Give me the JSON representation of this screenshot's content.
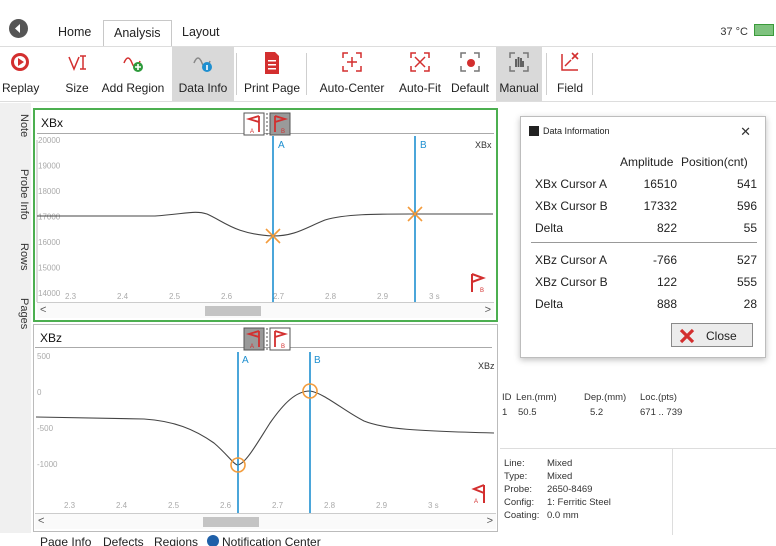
{
  "tabs": {
    "home": "Home",
    "analysis": "Analysis",
    "layout": "Layout"
  },
  "status": {
    "temperature": "37 °C"
  },
  "toolbar": {
    "replay": "Replay",
    "size": "Size",
    "add_region": "Add Region",
    "data_info": "Data Info",
    "print_page": "Print Page",
    "auto_center": "Auto-Center",
    "auto_fit": "Auto-Fit",
    "default": "Default",
    "manual": "Manual",
    "field": "Field"
  },
  "side_tabs": {
    "note": "Note",
    "probe_info": "Probe Info",
    "rows": "Rows",
    "pages": "Pages"
  },
  "panel_xbx": {
    "title": "XBx",
    "channel_label": "XBx",
    "cursor_a": "A",
    "cursor_b": "B",
    "y_ticks": [
      "20000",
      "19000",
      "18000",
      "17000",
      "16000",
      "15000",
      "14000"
    ],
    "x_ticks": [
      "2.3",
      "2.4",
      "2.5",
      "2.6",
      "2.7",
      "2.8",
      "2.9",
      "3 s"
    ]
  },
  "panel_xbz": {
    "title": "XBz",
    "channel_label": "XBz",
    "cursor_a": "A",
    "cursor_b": "B",
    "y_ticks": [
      "500",
      "0",
      "-500",
      "-1000"
    ],
    "x_ticks": [
      "2.3",
      "2.4",
      "2.5",
      "2.6",
      "2.7",
      "2.8",
      "2.9",
      "3 s"
    ]
  },
  "dialog": {
    "title": "Data Information",
    "col_amplitude": "Amplitude",
    "col_position": "Position(cnt)",
    "rows": [
      {
        "label": "XBx Cursor A",
        "amplitude": "16510",
        "position": "541"
      },
      {
        "label": "XBx Cursor B",
        "amplitude": "17332",
        "position": "596"
      },
      {
        "label": "Delta",
        "amplitude": "822",
        "position": "55"
      },
      {
        "label": "XBz Cursor A",
        "amplitude": "-766",
        "position": "527"
      },
      {
        "label": "XBz Cursor B",
        "amplitude": "122",
        "position": "555"
      },
      {
        "label": "Delta",
        "amplitude": "888",
        "position": "28"
      }
    ],
    "close_label": "Close"
  },
  "indication": {
    "hdr_id": "ID",
    "hdr_len": "Len.(mm)",
    "hdr_dep": "Dep.(mm)",
    "hdr_loc": "Loc.(pts)",
    "id": "1",
    "len": "50.5",
    "dep": "5.2",
    "loc": "671 .. 739"
  },
  "probe_info": {
    "line_label": "Line:",
    "line_value": "Mixed",
    "type_label": "Type:",
    "type_value": "Mixed",
    "probe_label": "Probe:",
    "probe_value": "2650-8469",
    "config_label": "Config:",
    "config_value": "1: Ferritic Steel",
    "coating_label": "Coating:",
    "coating_value": "0.0 mm"
  },
  "bottom_tabs": {
    "page_info": "Page Info",
    "defects": "Defects",
    "regions": "Regions",
    "notification": "Notification Center"
  },
  "colors": {
    "accent_green": "#4caf50",
    "cursor_blue": "#1e8fd0",
    "marker_orange": "#f39c3c",
    "brand_red": "#d32f2f"
  }
}
